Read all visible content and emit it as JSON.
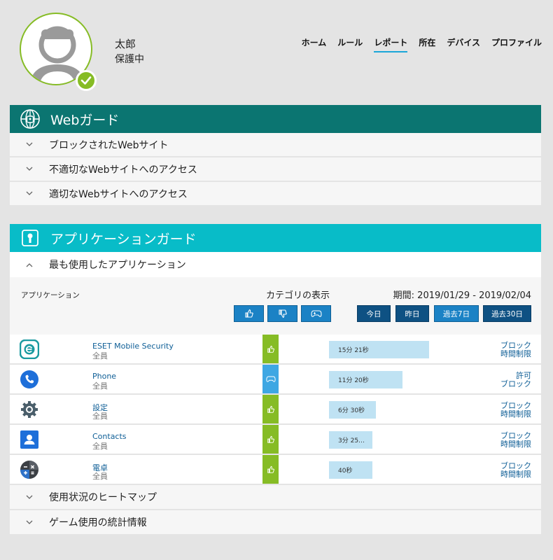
{
  "user": {
    "name": "太郎",
    "status": "保護中"
  },
  "nav": [
    "ホーム",
    "ルール",
    "レポート",
    "所在",
    "デバイス",
    "プロファイル"
  ],
  "web_guard": {
    "title": "Webガード",
    "rows": [
      "ブロックされたWebサイト",
      "不適切なWebサイトへのアクセス",
      "適切なWebサイトへのアクセス"
    ]
  },
  "app_guard": {
    "title": "アプリケーションガード",
    "expanded_row": "最も使用したアプリケーション",
    "col_app": "アプリケーション",
    "col_category": "カテゴリの表示",
    "period": "期間: 2019/01/29 - 2019/02/04",
    "period_buttons": [
      "今日",
      "昨日",
      "過去7日",
      "過去30日"
    ],
    "apps": [
      {
        "name": "ESET Mobile Security",
        "group": "全員",
        "category": "like",
        "time": "15分 21秒",
        "usage": 0.3,
        "actions": [
          "ブロック",
          "時間制限"
        ],
        "icon": "eset-icon"
      },
      {
        "name": "Phone",
        "group": "全員",
        "category": "game",
        "time": "11分 20秒",
        "usage": 0.22,
        "actions": [
          "許可",
          "ブロック"
        ],
        "icon": "phone-icon"
      },
      {
        "name": "設定",
        "group": "全員",
        "category": "like",
        "time": "6分 30秒",
        "usage": 0.14,
        "actions": [
          "ブロック",
          "時間制限"
        ],
        "icon": "settings-icon"
      },
      {
        "name": "Contacts",
        "group": "全員",
        "category": "like",
        "time": "3分 25…",
        "usage": 0.13,
        "actions": [
          "ブロック",
          "時間制限"
        ],
        "icon": "contacts-icon"
      },
      {
        "name": "電卓",
        "group": "全員",
        "category": "like",
        "time": "40秒",
        "usage": 0.13,
        "actions": [
          "ブロック",
          "時間制限"
        ],
        "icon": "calculator-icon"
      }
    ],
    "bottom_rows": [
      "使用状況のヒートマップ",
      "ゲーム使用の統計情報"
    ]
  },
  "colors": {
    "web_header": "#0b7571",
    "app_header": "#08bcc8",
    "like": "#86bc25",
    "game": "#3ea7e3",
    "bar": "#bfe2f3"
  }
}
